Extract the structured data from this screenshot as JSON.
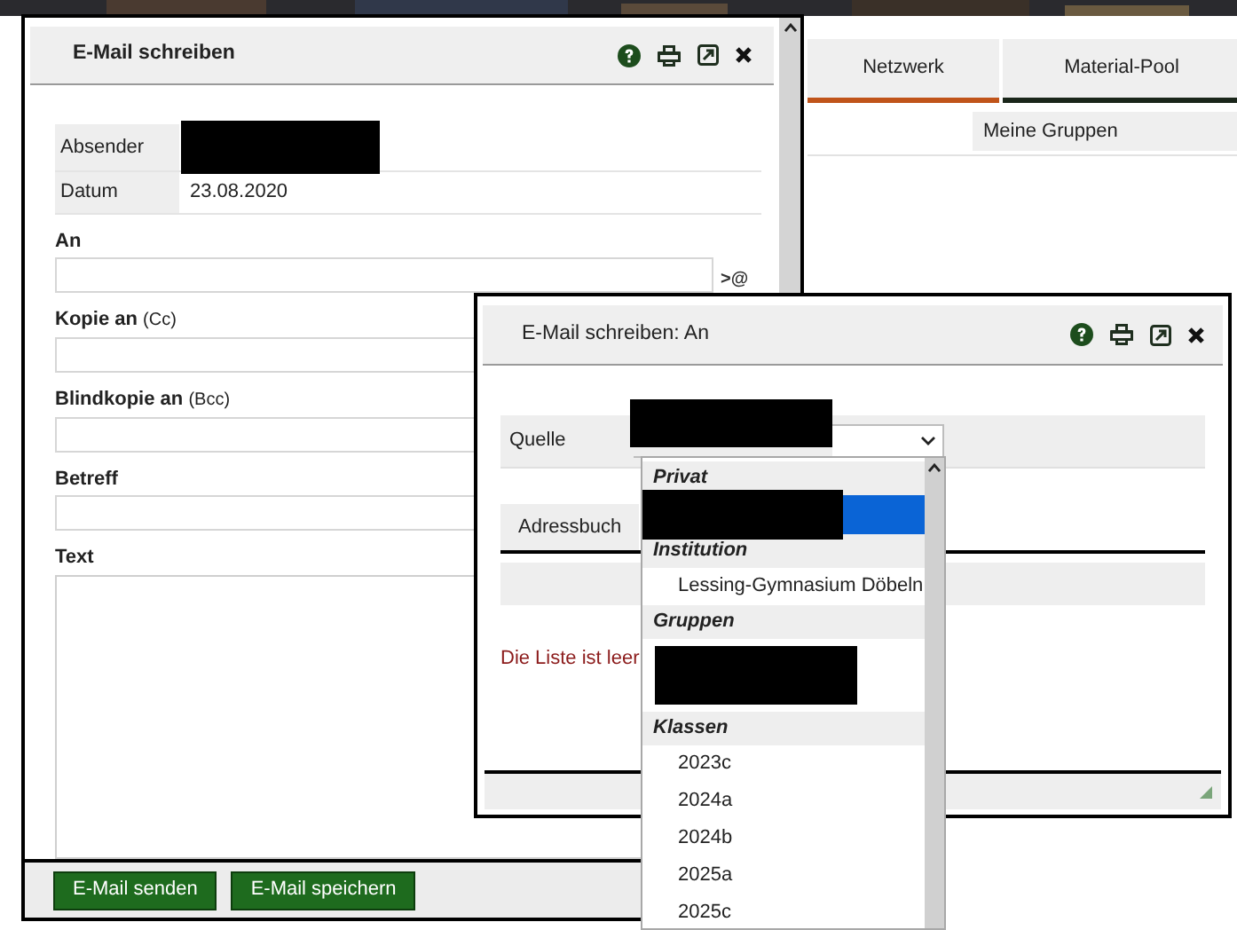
{
  "background_tabs": [
    {
      "label": "Netzwerk",
      "selected": true
    },
    {
      "label": "Material-Pool",
      "selected": false
    }
  ],
  "sub_tab": "Meine Gruppen",
  "compose_window": {
    "title": "E-Mail schreiben",
    "info_rows": [
      {
        "label": "Absender",
        "redacted": true
      },
      {
        "label": "Datum",
        "value": "23.08.2020",
        "redacted": false
      }
    ],
    "fields": [
      {
        "label": "An",
        "kind": "line",
        "action": ">@"
      },
      {
        "label": "Kopie an",
        "suffix": "(Cc)",
        "kind": "line"
      },
      {
        "label": "Blindkopie an",
        "suffix": "(Bcc)",
        "kind": "line"
      },
      {
        "label": "Betreff",
        "kind": "line"
      },
      {
        "label": "Text",
        "kind": "area"
      }
    ],
    "buttons": [
      "E-Mail senden",
      "E-Mail speichern"
    ]
  },
  "recipient_window": {
    "title": "E-Mail schreiben: An",
    "source": {
      "label": "Quelle",
      "redacted": true
    },
    "tabs": [
      {
        "label": "Adressbuch",
        "selected": true
      }
    ],
    "empty_message": "Die Liste ist leer",
    "dropdown": {
      "groups": [
        {
          "header": "Privat",
          "items": [
            {
              "redacted": true,
              "selected": true
            }
          ]
        },
        {
          "header": "Institution",
          "items": [
            {
              "label": "Lessing-Gymnasium Döbeln",
              "redacted": false,
              "selected": false
            }
          ]
        },
        {
          "header": "Gruppen",
          "items": [
            {
              "redacted": true,
              "selected": false
            }
          ]
        },
        {
          "header": "Klassen",
          "items": [
            {
              "label": "2023c",
              "redacted": false,
              "selected": false
            },
            {
              "label": "2024a",
              "redacted": false,
              "selected": false
            },
            {
              "label": "2024b",
              "redacted": false,
              "selected": false
            },
            {
              "label": "2025a",
              "redacted": false,
              "selected": false
            },
            {
              "label": "2025c",
              "redacted": false,
              "selected": false
            }
          ]
        }
      ]
    }
  }
}
